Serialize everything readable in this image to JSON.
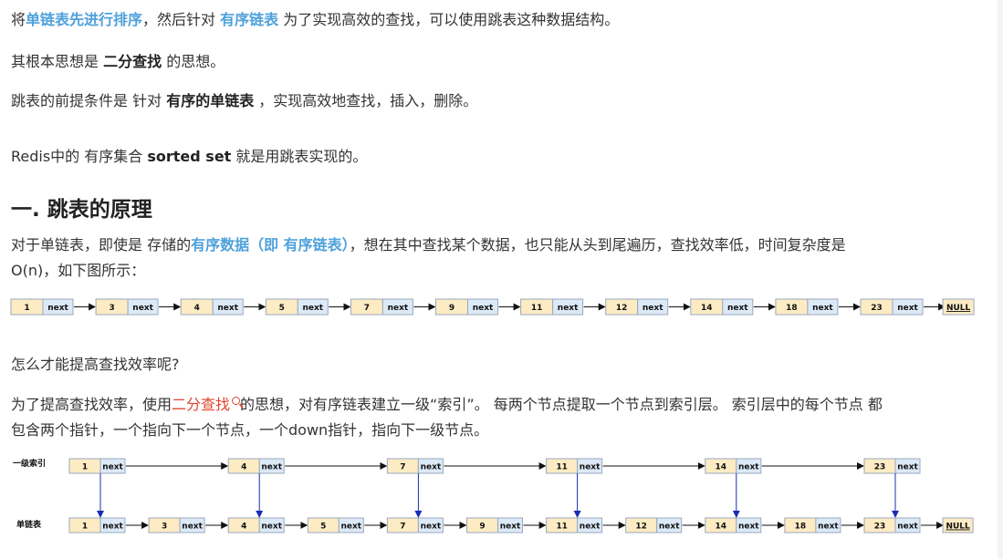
{
  "intro": {
    "p1": {
      "pre": "将",
      "em1": "单链表先进行排序",
      "mid": "，然后针对 ",
      "em2": "有序链表",
      "post": " 为了实现高效的查找，可以使用跳表这种数据结构。"
    },
    "p2": {
      "pre": "其根本思想是 ",
      "bold": "二分查找",
      "post": " 的思想。"
    },
    "p3": {
      "pre": "跳表的前提条件是 针对 ",
      "bold": "有序的单链表",
      "post": " ，实现高效地查找，插入，删除。"
    },
    "p4": {
      "pre": "Redis中的 有序集合 ",
      "bold": "sorted set",
      "post": " 就是用跳表实现的。"
    }
  },
  "section": {
    "heading": "一. 跳表的原理",
    "p5": {
      "pre": "对于单链表，即使是 存储的",
      "em": "有序数据（即 有序链表）",
      "post": "，想在其中查找某个数据，也只能从头到尾遍历，查找效率低，时间复杂度是"
    },
    "p5b": "O(n)，如下图所示：",
    "p6": "怎么才能提高查找效率呢?",
    "p7": {
      "pre": "为了提高查找效率，使用",
      "link": "二分查找",
      "post": "的思想，对有序链表建立一级“索引”。 每两个节点提取一个节点到索引层。 索引层中的每个节点 都"
    },
    "p7b": "包含两个指针，一个指向下一个节点，一个down指针，指向下一级节点。"
  },
  "diagram1": {
    "nodes": [
      "1",
      "3",
      "4",
      "5",
      "7",
      "9",
      "11",
      "12",
      "14",
      "18",
      "23"
    ],
    "next_label": "next",
    "null_label": "NULL"
  },
  "diagram2": {
    "index_label": "一级索引",
    "list_label": "单链表",
    "index_nodes": [
      "1",
      "4",
      "7",
      "11",
      "14",
      "23"
    ],
    "list_nodes": [
      "1",
      "3",
      "4",
      "5",
      "7",
      "9",
      "11",
      "12",
      "14",
      "18",
      "23"
    ],
    "next_label": "next",
    "null_label": "NULL"
  },
  "colors": {
    "value_cell": "#fdebc4",
    "next_cell": "#dce9f7",
    "border": "#9aa9bc",
    "link": "#4ea1db",
    "search_link": "#e1462e",
    "down_arrow": "#1a2cb3"
  }
}
